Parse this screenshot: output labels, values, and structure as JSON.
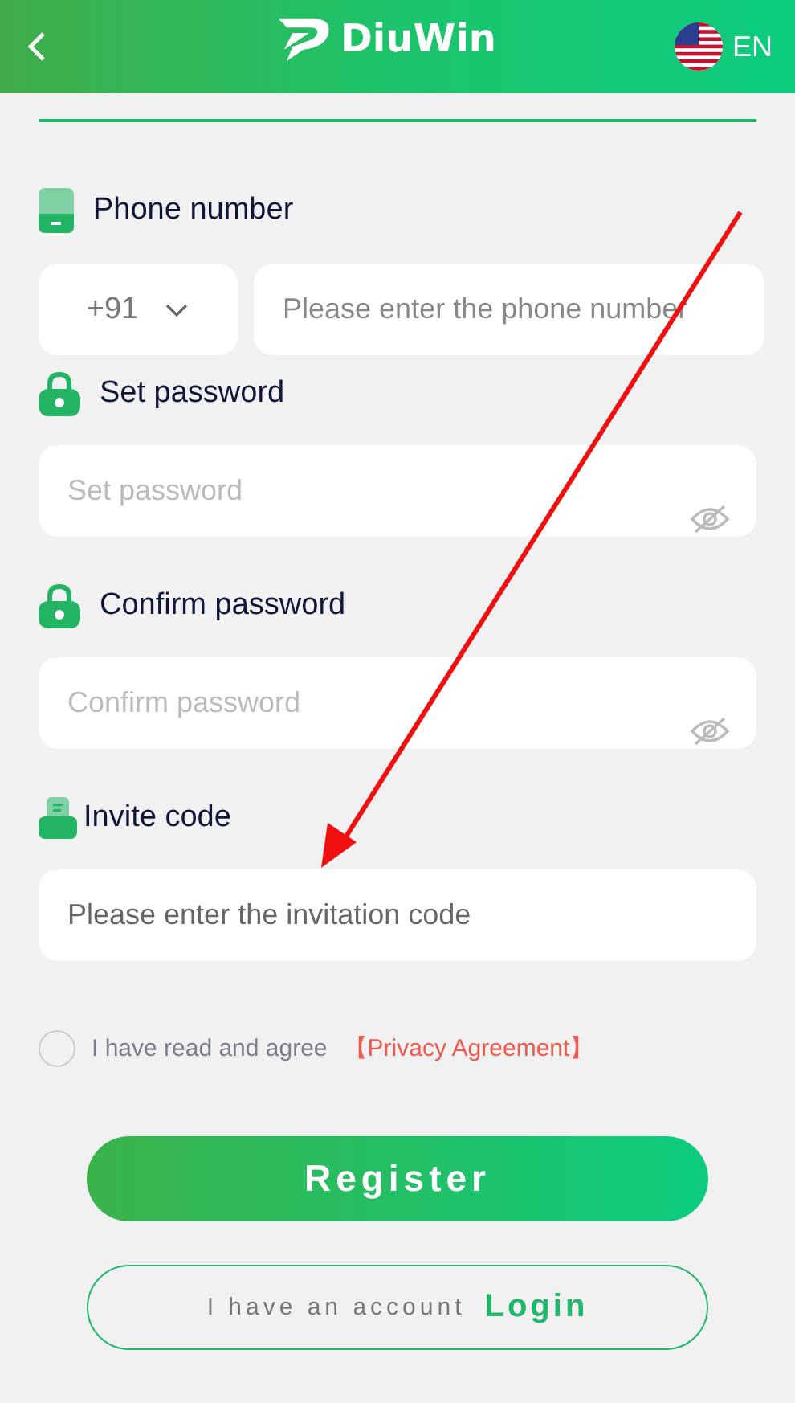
{
  "header": {
    "logo_text": "DiuWin",
    "language": "EN"
  },
  "phone": {
    "label": "Phone number",
    "country_code": "+91",
    "placeholder": "Please enter the phone number"
  },
  "password_fields": [
    {
      "label": "Set password",
      "placeholder": "Set password"
    },
    {
      "label": "Confirm password",
      "placeholder": "Confirm password"
    }
  ],
  "invite": {
    "label": "Invite code",
    "placeholder": "Please enter the invitation code"
  },
  "agreement": {
    "checked": false,
    "text": "I have read and agree",
    "link": "【Privacy Agreement】"
  },
  "register_button": "Register",
  "login_button": {
    "prefix": "I have an account",
    "action": "Login"
  }
}
